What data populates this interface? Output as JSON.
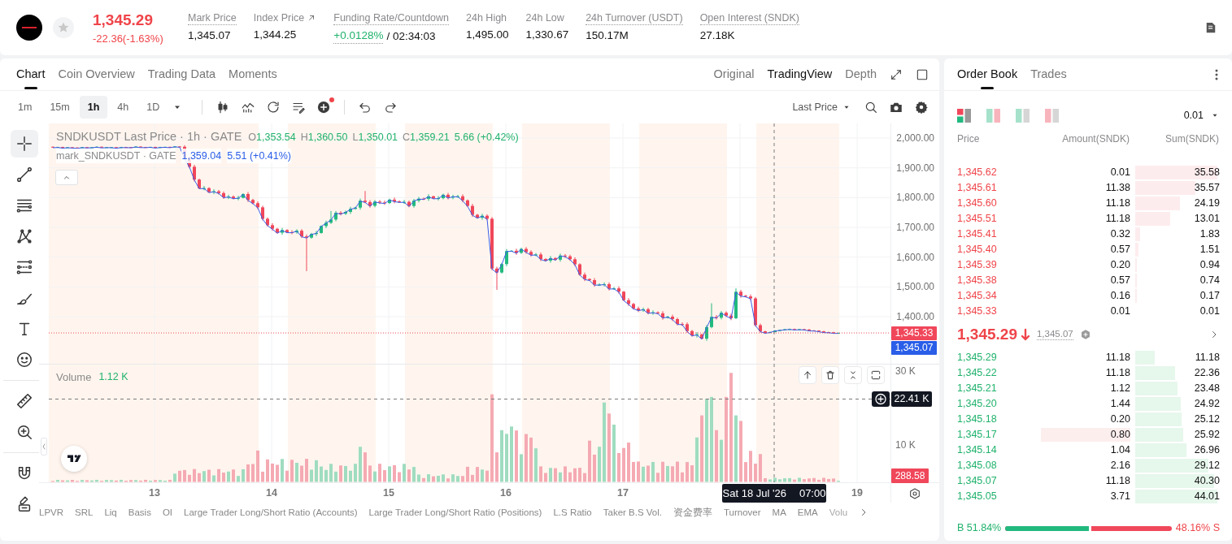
{
  "header": {
    "price": "1,345.29",
    "change": "-22.36(-1.63%)",
    "falling": true,
    "stats": [
      {
        "kind": "plain",
        "label": "Mark Price",
        "value": "1,345.07",
        "underlined": true,
        "external": false
      },
      {
        "kind": "plain",
        "label": "Index Price",
        "value": "1,344.25",
        "underlined": false,
        "external": true
      },
      {
        "kind": "funding",
        "label": "Funding Rate/Countdown",
        "rate": "+0.0128%",
        "countdown": "/ 02:34:03",
        "underlined": true,
        "external": false
      },
      {
        "kind": "plain",
        "label": "24h High",
        "value": "1,495.00",
        "underlined": false,
        "external": false
      },
      {
        "kind": "plain",
        "label": "24h Low",
        "value": "1,330.67",
        "underlined": false,
        "external": false
      },
      {
        "kind": "plain",
        "label": "24h Turnover (USDT)",
        "value": "150.17M",
        "underlined": true,
        "external": false
      },
      {
        "kind": "plain",
        "label": "Open Interest (SNDK)",
        "value": "27.18K",
        "underlined": true,
        "external": false
      }
    ]
  },
  "chart": {
    "tabs": [
      {
        "label": "Chart",
        "selected": true
      },
      {
        "label": "Coin Overview",
        "selected": false
      },
      {
        "label": "Trading Data",
        "selected": false
      },
      {
        "label": "Moments",
        "selected": false
      }
    ],
    "views": [
      {
        "label": "Original",
        "selected": false
      },
      {
        "label": "TradingView",
        "selected": true
      },
      {
        "label": "Depth",
        "selected": false
      }
    ],
    "intervals": [
      {
        "label": "1m",
        "selected": false
      },
      {
        "label": "15m",
        "selected": false
      },
      {
        "label": "1h",
        "selected": true
      },
      {
        "label": "4h",
        "selected": false
      },
      {
        "label": "1D",
        "selected": false
      }
    ],
    "price_source": "Last Price",
    "drawing_tools": [
      [
        {
          "kind": "crosshair",
          "selected": true
        },
        {
          "kind": "trend-line",
          "selected": false
        },
        {
          "kind": "horizontal-lines",
          "selected": false
        },
        {
          "kind": "pattern",
          "selected": false
        },
        {
          "kind": "channel",
          "selected": false
        },
        {
          "kind": "brush",
          "selected": false
        },
        {
          "kind": "text",
          "selected": false
        },
        {
          "kind": "emoji",
          "selected": false
        }
      ],
      [
        {
          "kind": "ruler",
          "selected": false
        },
        {
          "kind": "zoom",
          "selected": false
        }
      ],
      [
        {
          "kind": "magnet",
          "selected": false
        },
        {
          "kind": "lock",
          "selected": false
        }
      ]
    ],
    "legend": {
      "symbol": "SNDKUSDT Last Price · 1h · GATE",
      "ohlc": [
        {
          "key": "O",
          "value": "1,353.54"
        },
        {
          "key": "H",
          "value": "1,360.50"
        },
        {
          "key": "L",
          "value": "1,350.01"
        },
        {
          "key": "C",
          "value": "1,359.21"
        }
      ],
      "change": "5.66 (+0.42%)",
      "mark_symbol": "mark_SNDKUSDT · GATE",
      "mark_value": "1,359.04",
      "mark_change": "5.51 (+0.41%)"
    },
    "price_axis": {
      "labels": [
        "2,000.00",
        "1,900.00",
        "1,800.00",
        "1,700.00",
        "1,600.00",
        "1,500.00",
        "1,400.00"
      ],
      "tags": [
        {
          "text": "1,345.33",
          "color": "#f0475a"
        },
        {
          "text": "1,345.07",
          "color": "#2a5ee8"
        }
      ]
    },
    "volume": {
      "label": "Volume",
      "value": "1.12 K",
      "axis_labels": [
        "30 K",
        "10 K"
      ],
      "tags": [
        {
          "kind": "crosshair",
          "text": "22.41 K"
        },
        {
          "kind": "last",
          "text": "288.58"
        }
      ]
    },
    "time_axis": [
      {
        "kind": "day",
        "text": "13"
      },
      {
        "kind": "day",
        "text": "14"
      },
      {
        "kind": "day",
        "text": "15"
      },
      {
        "kind": "day",
        "text": "16"
      },
      {
        "kind": "day",
        "text": "17"
      },
      {
        "kind": "crosshair",
        "date": "Sat 18 Jul '26",
        "time": "07:00"
      },
      {
        "kind": "day",
        "text": "19"
      }
    ],
    "indicators": [
      "LPVR",
      "SRL",
      "Liq",
      "Basis",
      "OI",
      "Large Trader Long/Short Ratio (Accounts)",
      "Large Trader Long/Short Ratio (Positions)",
      "L.S Ratio",
      "Taker B.S Vol.",
      "资金费率",
      "Turnover",
      "MA",
      "EMA",
      "Volu"
    ]
  },
  "order_book": {
    "tabs": [
      {
        "label": "Order Book",
        "selected": true
      },
      {
        "label": "Trades",
        "selected": false
      }
    ],
    "layouts": [
      {
        "kind": "both",
        "selected": true
      },
      {
        "kind": "split",
        "selected": false
      },
      {
        "kind": "bids",
        "selected": false
      },
      {
        "kind": "asks",
        "selected": false
      }
    ],
    "precision": "0.01",
    "columns": [
      "Price",
      "Amount(SNDK)",
      "Sum(SNDK)"
    ],
    "asks": [
      {
        "price": "1,345.62",
        "amount": "0.01",
        "sum": "35.58",
        "level": 1,
        "highlighted": false
      },
      {
        "price": "1,345.61",
        "amount": "11.38",
        "sum": "35.57",
        "level": 0.73,
        "highlighted": false
      },
      {
        "price": "1,345.60",
        "amount": "11.18",
        "sum": "24.19",
        "level": 0.54,
        "highlighted": false
      },
      {
        "price": "1,345.51",
        "amount": "11.18",
        "sum": "13.01",
        "level": 0.43,
        "highlighted": false
      },
      {
        "price": "1,345.41",
        "amount": "0.32",
        "sum": "1.83",
        "level": 0.06,
        "highlighted": false
      },
      {
        "price": "1,345.40",
        "amount": "0.57",
        "sum": "1.51",
        "level": 0.04,
        "highlighted": false
      },
      {
        "price": "1,345.39",
        "amount": "0.20",
        "sum": "0.94",
        "level": 0.02,
        "highlighted": false
      },
      {
        "price": "1,345.38",
        "amount": "0.57",
        "sum": "0.74",
        "level": 0.02,
        "highlighted": false
      },
      {
        "price": "1,345.34",
        "amount": "0.16",
        "sum": "0.17",
        "level": 0.01,
        "highlighted": false
      },
      {
        "price": "1,345.33",
        "amount": "0.01",
        "sum": "0.01",
        "highlighted": false
      }
    ],
    "mid": {
      "price": "1,345.29",
      "falling": true,
      "mark": "1,345.07"
    },
    "bids": [
      {
        "price": "1,345.29",
        "amount": "11.18",
        "sum": "11.18",
        "level": 0.24,
        "highlighted": false
      },
      {
        "price": "1,345.22",
        "amount": "11.18",
        "sum": "22.36",
        "level": 0.49,
        "highlighted": false
      },
      {
        "price": "1,345.21",
        "amount": "1.12",
        "sum": "23.48",
        "level": 0.51,
        "highlighted": false
      },
      {
        "price": "1,345.20",
        "amount": "1.44",
        "sum": "24.92",
        "level": 0.55,
        "highlighted": false
      },
      {
        "price": "1,345.18",
        "amount": "0.20",
        "sum": "25.12",
        "level": 0.56,
        "highlighted": false
      },
      {
        "price": "1,345.17",
        "amount": "0.80",
        "sum": "25.92",
        "level": 0.58,
        "highlighted": true
      },
      {
        "price": "1,345.14",
        "amount": "1.04",
        "sum": "26.96",
        "level": 0.62,
        "highlighted": false
      },
      {
        "price": "1,345.08",
        "amount": "2.16",
        "sum": "29.12",
        "level": 0.89,
        "highlighted": false
      },
      {
        "price": "1,345.07",
        "amount": "11.18",
        "sum": "40.30",
        "level": 0.96,
        "highlighted": false
      },
      {
        "price": "1,345.05",
        "amount": "3.71",
        "sum": "44.01",
        "level": 1,
        "highlighted": false
      }
    ],
    "ratio": {
      "buy": "B 51.84%",
      "sell": "48.16% S",
      "level": 0.5184
    }
  }
}
